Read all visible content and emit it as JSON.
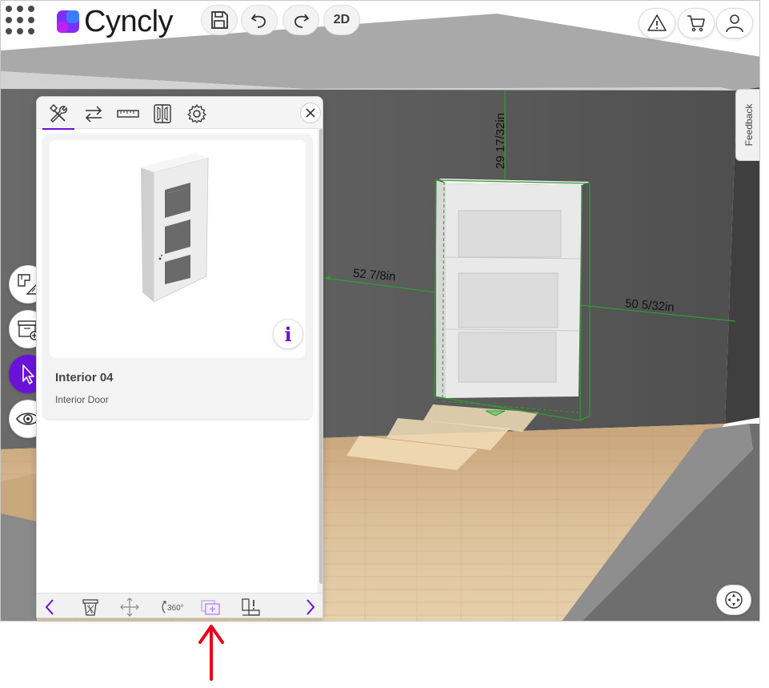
{
  "app": {
    "logo_text": "Cyncly",
    "view_toggle_label": "2D",
    "feedback_label": "Feedback"
  },
  "top_bar": {
    "buttons": [
      {
        "name": "save",
        "icon": "save-icon"
      },
      {
        "name": "undo",
        "icon": "undo-icon"
      },
      {
        "name": "redo",
        "icon": "redo-icon"
      },
      {
        "name": "view-2d",
        "label": "2D"
      }
    ],
    "right_buttons": [
      {
        "name": "warning",
        "icon": "warning-icon"
      },
      {
        "name": "cart",
        "icon": "cart-icon"
      },
      {
        "name": "user",
        "icon": "user-icon"
      }
    ]
  },
  "side_tools": [
    {
      "name": "floorplan",
      "icon": "floorplan-icon"
    },
    {
      "name": "add-cabinet",
      "icon": "add-cabinet-icon"
    },
    {
      "name": "select",
      "icon": "cursor-icon",
      "active": true
    },
    {
      "name": "view",
      "icon": "eye-icon"
    }
  ],
  "scene": {
    "dimensions": {
      "top": "29 17/32in",
      "left": "52 7/8in",
      "right": "50 5/32in"
    }
  },
  "panel": {
    "tabs": [
      {
        "name": "tools",
        "icon": "tools-icon",
        "active": true
      },
      {
        "name": "swap",
        "icon": "swap-icon"
      },
      {
        "name": "measure",
        "icon": "ruler-icon"
      },
      {
        "name": "door-style",
        "icon": "door-panel-icon"
      },
      {
        "name": "settings",
        "icon": "gear-icon"
      }
    ],
    "product": {
      "name": "Interior 04",
      "category": "Interior Door",
      "info_label": "i"
    },
    "toolbar": [
      {
        "name": "prev",
        "icon": "chevron-left-icon"
      },
      {
        "name": "delete",
        "icon": "trash-icon"
      },
      {
        "name": "move",
        "icon": "move-icon"
      },
      {
        "name": "rotate",
        "icon": "rotate-360-icon",
        "label": "360°"
      },
      {
        "name": "duplicate",
        "icon": "duplicate-icon",
        "highlighted": true
      },
      {
        "name": "report",
        "icon": "report-icon"
      },
      {
        "name": "next",
        "icon": "chevron-right-icon"
      }
    ]
  },
  "colors": {
    "accent": "#6b12d9",
    "annotation_arrow": "#e8001c",
    "selection": "#2f9e2f",
    "floor": "#d8b98c",
    "wall": "#5a5a5a"
  }
}
